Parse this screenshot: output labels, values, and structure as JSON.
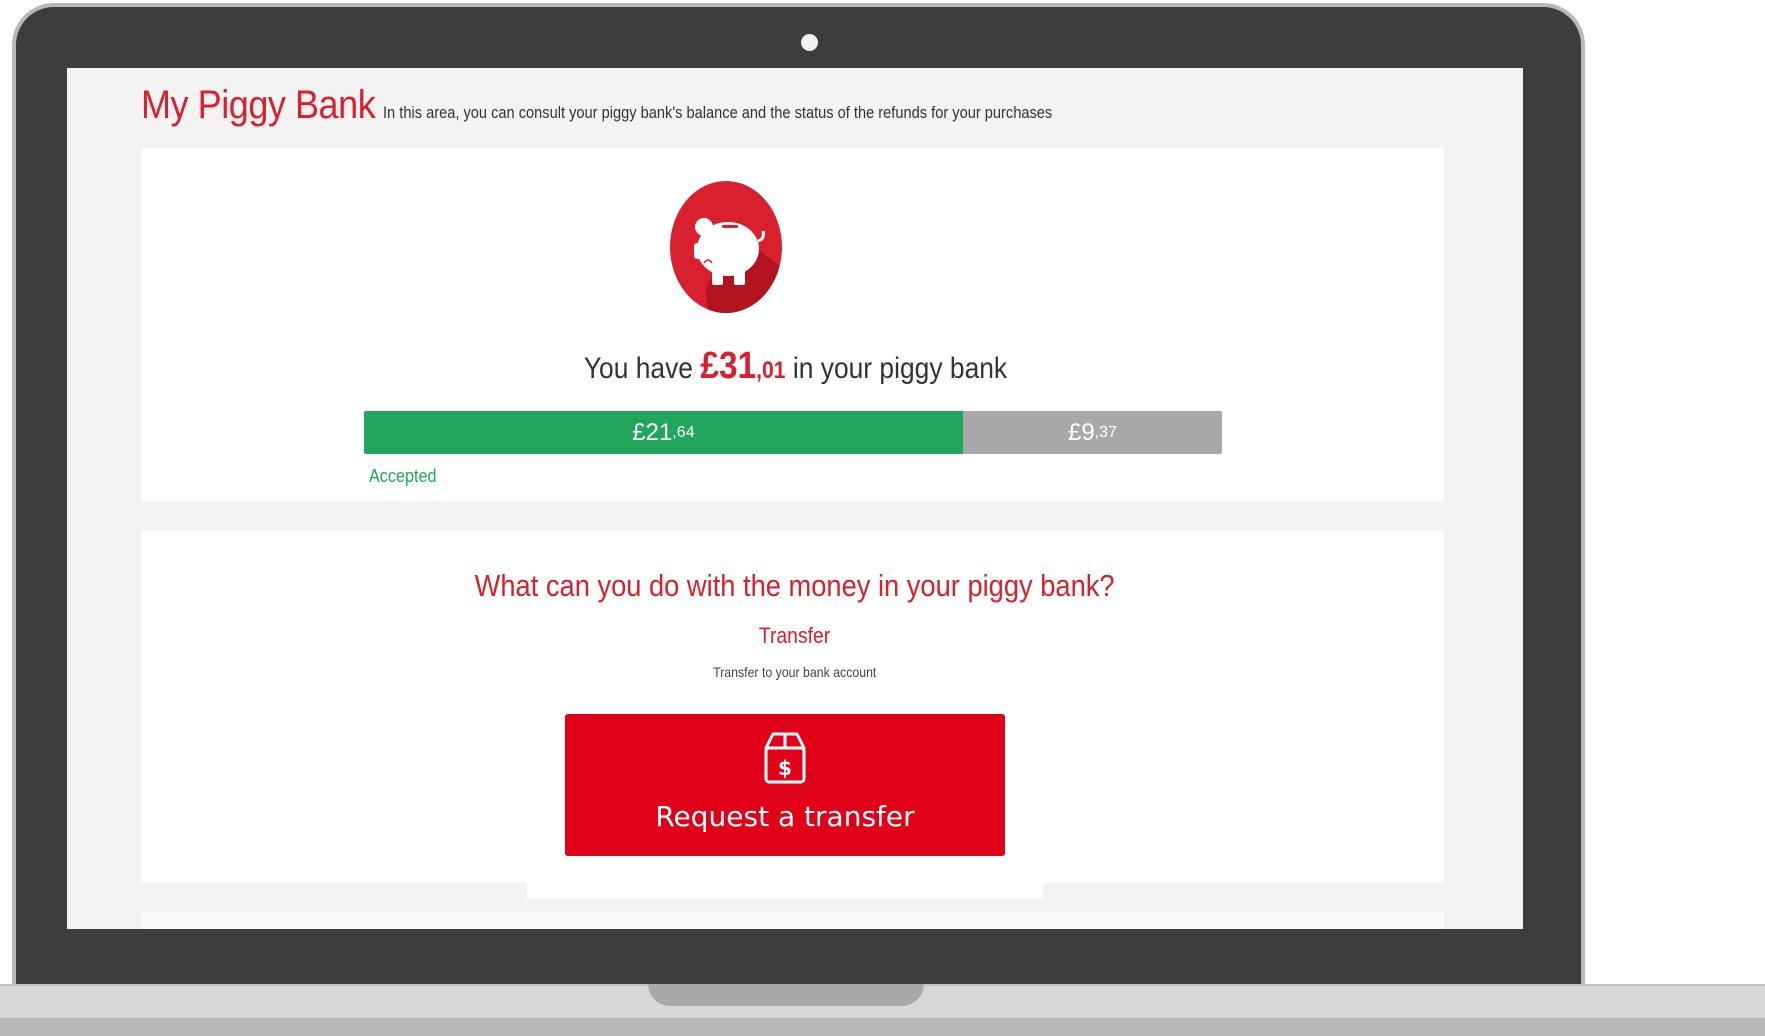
{
  "page": {
    "title": "My Piggy Bank",
    "subtitle": "In this area, you can consult your piggy bank's balance and the status of the refunds for your purchases"
  },
  "balance": {
    "prefix": "You have",
    "currency": "£",
    "whole": "31",
    "decimal": ",01",
    "suffix": "in your piggy bank"
  },
  "progress": {
    "accepted_currency": "£",
    "accepted_whole": " 21",
    "accepted_decimal": ",64",
    "pending_currency": "£",
    "pending_whole": " 9",
    "pending_decimal": ",37",
    "accepted_fraction": 0.698,
    "accepted_label": "Accepted"
  },
  "actions": {
    "question": "What can you do with the money in your piggy bank?",
    "transfer_title": "Transfer",
    "transfer_description": "Transfer to your bank account",
    "transfer_button_label": "Request a transfer"
  },
  "icons": {
    "piggy": "piggy-bank-icon",
    "transfer": "box-dollar-icon"
  },
  "colors": {
    "brand_red": "#d9202e",
    "button_red": "#e00017",
    "accepted_green": "#22a55d",
    "pending_gray": "#a9a9a9"
  }
}
